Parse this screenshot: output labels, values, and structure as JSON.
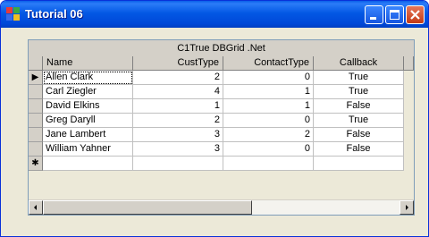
{
  "window": {
    "title": "Tutorial 06"
  },
  "grid": {
    "caption": "C1True DBGrid .Net",
    "columns": [
      "Name",
      "CustType",
      "ContactType",
      "Callback"
    ],
    "rows": [
      [
        "Allen Clark",
        "2",
        "0",
        "True"
      ],
      [
        "Carl Ziegler",
        "4",
        "1",
        "True"
      ],
      [
        "David Elkins",
        "1",
        "1",
        "False"
      ],
      [
        "Greg Daryll",
        "2",
        "0",
        "True"
      ],
      [
        "Jane Lambert",
        "3",
        "2",
        "False"
      ],
      [
        "William Yahner",
        "3",
        "0",
        "False"
      ]
    ],
    "current_row_indicator": "▶",
    "new_row_indicator": "✱"
  },
  "icons": {
    "app": "app-window-icon",
    "minimize": "minimize-icon",
    "maximize": "maximize-icon",
    "close": "close-icon",
    "scroll_left": "arrow-left-icon",
    "scroll_right": "arrow-right-icon"
  }
}
